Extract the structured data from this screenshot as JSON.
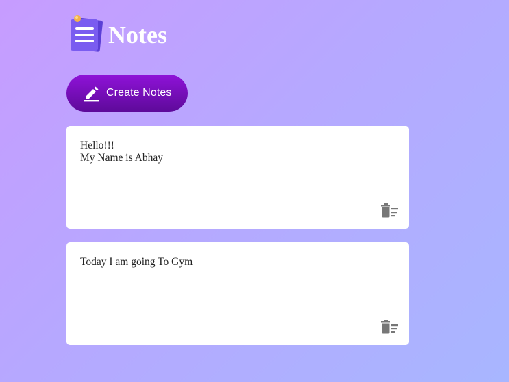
{
  "app": {
    "title": "Notes",
    "logo_icon": "notes-logo-icon"
  },
  "toolbar": {
    "create_label": "Create Notes",
    "create_icon": "pen-icon"
  },
  "notes": [
    {
      "text": "Hello!!!\nMy Name is Abhay",
      "delete_icon": "delete-sweep-icon"
    },
    {
      "text": "Today I am going To Gym",
      "delete_icon": "delete-sweep-icon"
    }
  ],
  "colors": {
    "background_start": "#c79cff",
    "background_end": "#a8b6ff",
    "button_top": "#8f12d8",
    "button_bottom": "#5e0a9a",
    "card": "#ffffff",
    "icon_gray": "#777777"
  }
}
